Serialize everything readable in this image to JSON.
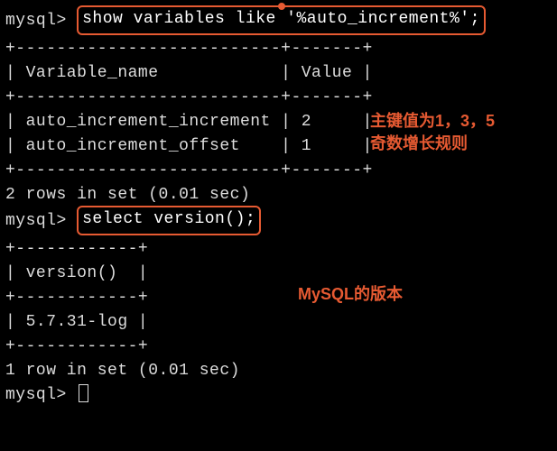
{
  "prompt": "mysql> ",
  "query1": "show variables like '%auto_increment%';",
  "result1": {
    "border_top": "+--------------------------+-------+",
    "header_row": "| Variable_name            | Value |",
    "border_mid": "+--------------------------+-------+",
    "row1": "| auto_increment_increment | 2     |",
    "row2": "| auto_increment_offset    | 1     |",
    "border_bottom": "+--------------------------+-------+",
    "summary": "2 rows in set (0.01 sec)"
  },
  "annotation1_line1": "主键值为1，3，5",
  "annotation1_line2": "奇数增长规则",
  "query2": "select version();",
  "result2": {
    "border_top": "+------------+",
    "header_row": "| version()  |",
    "border_mid": "+------------+",
    "row1": "| 5.7.31-log |",
    "border_bottom": "+------------+",
    "summary": "1 row in set (0.01 sec)"
  },
  "annotation2": "MySQL的版本",
  "blank": ""
}
